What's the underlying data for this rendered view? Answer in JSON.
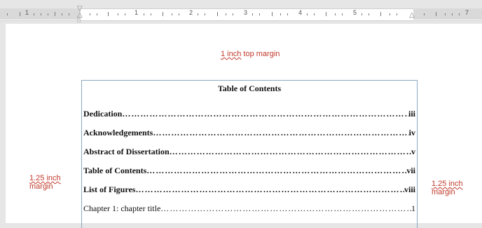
{
  "ruler": {
    "numbers": [
      "1",
      "1",
      "2",
      "3",
      "4",
      "5",
      "7"
    ]
  },
  "annotations": {
    "top_margin": {
      "underlined": "1 inch",
      "rest": " top margin"
    },
    "left_margin": {
      "underlined": "1.25 inch",
      "rest": "margin"
    },
    "right_margin": {
      "underlined": "1.25 inch",
      "rest": "margin"
    }
  },
  "toc": {
    "title": "Table of Contents",
    "entries": [
      {
        "label": "Dedication",
        "page": "iii",
        "bold": true
      },
      {
        "label": "Acknowledgements ",
        "page": "iv",
        "bold": true
      },
      {
        "label": "Abstract of Dissertation ",
        "page": "v",
        "bold": true
      },
      {
        "label": "Table of Contents",
        "page": "vii",
        "bold": true
      },
      {
        "label": "List of Figures",
        "page": "viii",
        "bold": true
      },
      {
        "label": "Chapter 1: chapter title",
        "page": "1",
        "bold": false
      }
    ]
  },
  "colors": {
    "annotation": "#c0392b",
    "margin_line": "#8aa9c4"
  }
}
